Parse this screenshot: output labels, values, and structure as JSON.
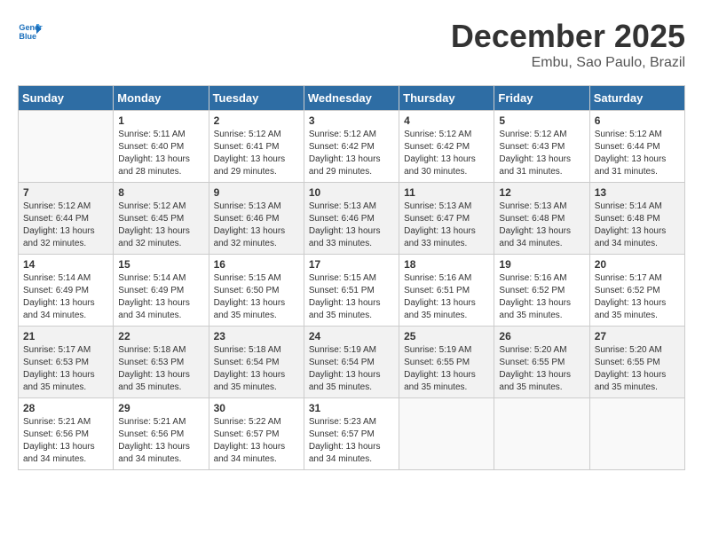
{
  "header": {
    "logo_line1": "General",
    "logo_line2": "Blue",
    "month": "December 2025",
    "location": "Embu, Sao Paulo, Brazil"
  },
  "weekdays": [
    "Sunday",
    "Monday",
    "Tuesday",
    "Wednesday",
    "Thursday",
    "Friday",
    "Saturday"
  ],
  "weeks": [
    [
      {
        "day": "",
        "info": ""
      },
      {
        "day": "1",
        "info": "Sunrise: 5:11 AM\nSunset: 6:40 PM\nDaylight: 13 hours\nand 28 minutes."
      },
      {
        "day": "2",
        "info": "Sunrise: 5:12 AM\nSunset: 6:41 PM\nDaylight: 13 hours\nand 29 minutes."
      },
      {
        "day": "3",
        "info": "Sunrise: 5:12 AM\nSunset: 6:42 PM\nDaylight: 13 hours\nand 29 minutes."
      },
      {
        "day": "4",
        "info": "Sunrise: 5:12 AM\nSunset: 6:42 PM\nDaylight: 13 hours\nand 30 minutes."
      },
      {
        "day": "5",
        "info": "Sunrise: 5:12 AM\nSunset: 6:43 PM\nDaylight: 13 hours\nand 31 minutes."
      },
      {
        "day": "6",
        "info": "Sunrise: 5:12 AM\nSunset: 6:44 PM\nDaylight: 13 hours\nand 31 minutes."
      }
    ],
    [
      {
        "day": "7",
        "info": "Sunrise: 5:12 AM\nSunset: 6:44 PM\nDaylight: 13 hours\nand 32 minutes."
      },
      {
        "day": "8",
        "info": "Sunrise: 5:12 AM\nSunset: 6:45 PM\nDaylight: 13 hours\nand 32 minutes."
      },
      {
        "day": "9",
        "info": "Sunrise: 5:13 AM\nSunset: 6:46 PM\nDaylight: 13 hours\nand 32 minutes."
      },
      {
        "day": "10",
        "info": "Sunrise: 5:13 AM\nSunset: 6:46 PM\nDaylight: 13 hours\nand 33 minutes."
      },
      {
        "day": "11",
        "info": "Sunrise: 5:13 AM\nSunset: 6:47 PM\nDaylight: 13 hours\nand 33 minutes."
      },
      {
        "day": "12",
        "info": "Sunrise: 5:13 AM\nSunset: 6:48 PM\nDaylight: 13 hours\nand 34 minutes."
      },
      {
        "day": "13",
        "info": "Sunrise: 5:14 AM\nSunset: 6:48 PM\nDaylight: 13 hours\nand 34 minutes."
      }
    ],
    [
      {
        "day": "14",
        "info": "Sunrise: 5:14 AM\nSunset: 6:49 PM\nDaylight: 13 hours\nand 34 minutes."
      },
      {
        "day": "15",
        "info": "Sunrise: 5:14 AM\nSunset: 6:49 PM\nDaylight: 13 hours\nand 34 minutes."
      },
      {
        "day": "16",
        "info": "Sunrise: 5:15 AM\nSunset: 6:50 PM\nDaylight: 13 hours\nand 35 minutes."
      },
      {
        "day": "17",
        "info": "Sunrise: 5:15 AM\nSunset: 6:51 PM\nDaylight: 13 hours\nand 35 minutes."
      },
      {
        "day": "18",
        "info": "Sunrise: 5:16 AM\nSunset: 6:51 PM\nDaylight: 13 hours\nand 35 minutes."
      },
      {
        "day": "19",
        "info": "Sunrise: 5:16 AM\nSunset: 6:52 PM\nDaylight: 13 hours\nand 35 minutes."
      },
      {
        "day": "20",
        "info": "Sunrise: 5:17 AM\nSunset: 6:52 PM\nDaylight: 13 hours\nand 35 minutes."
      }
    ],
    [
      {
        "day": "21",
        "info": "Sunrise: 5:17 AM\nSunset: 6:53 PM\nDaylight: 13 hours\nand 35 minutes."
      },
      {
        "day": "22",
        "info": "Sunrise: 5:18 AM\nSunset: 6:53 PM\nDaylight: 13 hours\nand 35 minutes."
      },
      {
        "day": "23",
        "info": "Sunrise: 5:18 AM\nSunset: 6:54 PM\nDaylight: 13 hours\nand 35 minutes."
      },
      {
        "day": "24",
        "info": "Sunrise: 5:19 AM\nSunset: 6:54 PM\nDaylight: 13 hours\nand 35 minutes."
      },
      {
        "day": "25",
        "info": "Sunrise: 5:19 AM\nSunset: 6:55 PM\nDaylight: 13 hours\nand 35 minutes."
      },
      {
        "day": "26",
        "info": "Sunrise: 5:20 AM\nSunset: 6:55 PM\nDaylight: 13 hours\nand 35 minutes."
      },
      {
        "day": "27",
        "info": "Sunrise: 5:20 AM\nSunset: 6:55 PM\nDaylight: 13 hours\nand 35 minutes."
      }
    ],
    [
      {
        "day": "28",
        "info": "Sunrise: 5:21 AM\nSunset: 6:56 PM\nDaylight: 13 hours\nand 34 minutes."
      },
      {
        "day": "29",
        "info": "Sunrise: 5:21 AM\nSunset: 6:56 PM\nDaylight: 13 hours\nand 34 minutes."
      },
      {
        "day": "30",
        "info": "Sunrise: 5:22 AM\nSunset: 6:57 PM\nDaylight: 13 hours\nand 34 minutes."
      },
      {
        "day": "31",
        "info": "Sunrise: 5:23 AM\nSunset: 6:57 PM\nDaylight: 13 hours\nand 34 minutes."
      },
      {
        "day": "",
        "info": ""
      },
      {
        "day": "",
        "info": ""
      },
      {
        "day": "",
        "info": ""
      }
    ]
  ]
}
